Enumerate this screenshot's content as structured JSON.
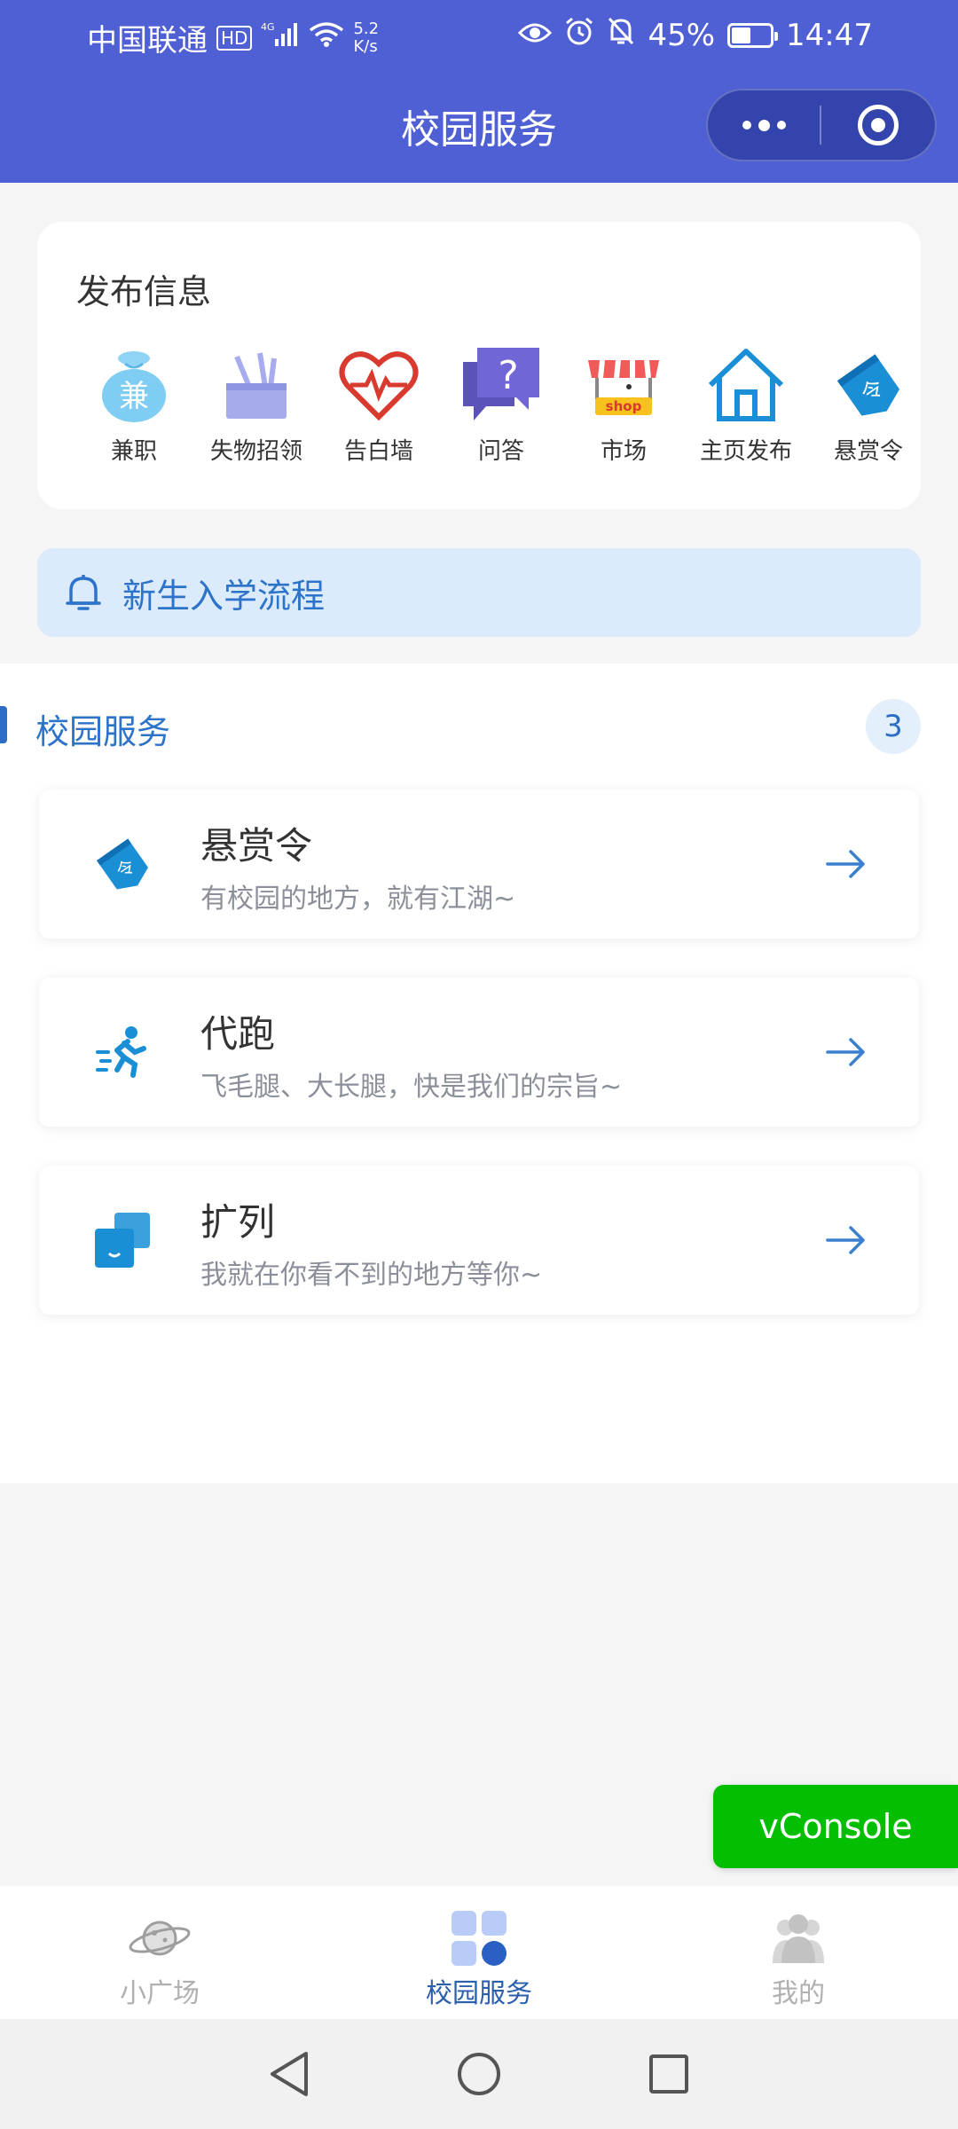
{
  "status_bar": {
    "carrier": "中国联通",
    "hd": "HD",
    "network_speed_value": "5.2",
    "network_speed_unit": "K/s",
    "battery": "45%",
    "time": "14:47"
  },
  "nav": {
    "title": "校园服务"
  },
  "publish": {
    "title": "发布信息",
    "items": [
      {
        "label": "兼职",
        "icon": "part-time-bag-icon"
      },
      {
        "label": "失物招领",
        "icon": "lost-found-box-icon"
      },
      {
        "label": "告白墙",
        "icon": "heart-pulse-icon"
      },
      {
        "label": "问答",
        "icon": "question-bubble-icon"
      },
      {
        "label": "市场",
        "icon": "shop-stall-icon"
      },
      {
        "label": "主页发布",
        "icon": "home-icon"
      },
      {
        "label": "悬赏令",
        "icon": "bounty-tag-icon"
      }
    ]
  },
  "notice": {
    "text": "新生入学流程"
  },
  "services": {
    "title": "校园服务",
    "count": "3",
    "items": [
      {
        "name": "悬赏令",
        "desc": "有校园的地方，就有江湖~"
      },
      {
        "name": "代跑",
        "desc": "飞毛腿、大长腿，快是我们的宗旨~"
      },
      {
        "name": "扩列",
        "desc": "我就在你看不到的地方等你~"
      }
    ]
  },
  "vconsole": {
    "label": "vConsole"
  },
  "tabbar": {
    "tabs": [
      {
        "label": "小广场"
      },
      {
        "label": "校园服务"
      },
      {
        "label": "我的"
      }
    ],
    "active_index": 1
  },
  "colors": {
    "header": "#4f5fd4",
    "accent": "#2c73c9",
    "vconsole": "#04be02"
  }
}
